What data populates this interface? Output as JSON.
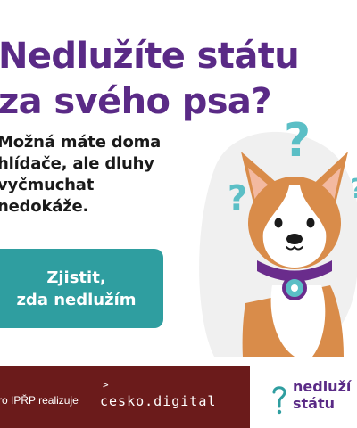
{
  "headline": {
    "line1": "Nedlužíte státu",
    "line2": "za svého psa?"
  },
  "subtext": {
    "line1": "Možná máte doma",
    "line2": "hlídače, ale dluhy",
    "line3": "vyčmuchat",
    "line4": "nedokáže."
  },
  "cta": {
    "line1": "Zjistit,",
    "line2": "zda nedlužím"
  },
  "footer": {
    "note": "ro IPŘP realizuje",
    "partner_arrow": ">",
    "partner_name": "cesko.digital",
    "brand_line1": "nedluží",
    "brand_line2": "státu"
  },
  "colors": {
    "headline": "#5a2a86",
    "cta_bg": "#2f9ea0",
    "footer_bg": "#6b1b1b",
    "question_marks": "#5bbfc6",
    "dog_fur": "#d98c4a",
    "collar": "#6a2c8c"
  },
  "icons": [
    "dog-illustration",
    "question-mark-icon",
    "nedluzi-lock-icon",
    "chevron-right-icon"
  ]
}
